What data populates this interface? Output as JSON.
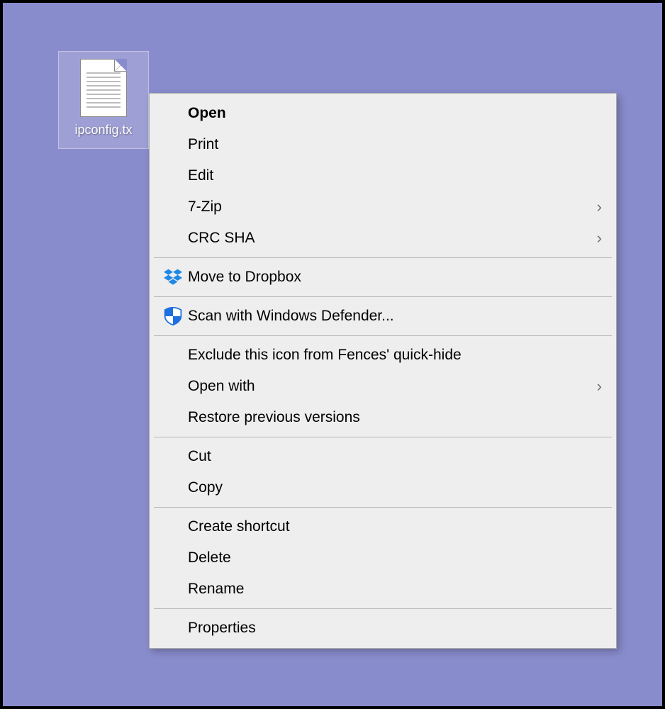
{
  "file": {
    "name": "ipconfig.tx"
  },
  "menu": {
    "items": [
      {
        "label": "Open",
        "bold": true,
        "submenu": false,
        "icon": null
      },
      {
        "label": "Print",
        "bold": false,
        "submenu": false,
        "icon": null
      },
      {
        "label": "Edit",
        "bold": false,
        "submenu": false,
        "icon": null
      },
      {
        "label": "7-Zip",
        "bold": false,
        "submenu": true,
        "icon": null
      },
      {
        "label": "CRC SHA",
        "bold": false,
        "submenu": true,
        "icon": null
      },
      {
        "separator": true
      },
      {
        "label": "Move to Dropbox",
        "bold": false,
        "submenu": false,
        "icon": "dropbox"
      },
      {
        "separator": true
      },
      {
        "label": "Scan with Windows Defender...",
        "bold": false,
        "submenu": false,
        "icon": "defender"
      },
      {
        "separator": true
      },
      {
        "label": "Exclude this icon from Fences' quick-hide",
        "bold": false,
        "submenu": false,
        "icon": null
      },
      {
        "label": "Open with",
        "bold": false,
        "submenu": true,
        "icon": null
      },
      {
        "label": "Restore previous versions",
        "bold": false,
        "submenu": false,
        "icon": null
      },
      {
        "separator": true
      },
      {
        "label": "Cut",
        "bold": false,
        "submenu": false,
        "icon": null
      },
      {
        "label": "Copy",
        "bold": false,
        "submenu": false,
        "icon": null
      },
      {
        "separator": true
      },
      {
        "label": "Create shortcut",
        "bold": false,
        "submenu": false,
        "icon": null
      },
      {
        "label": "Delete",
        "bold": false,
        "submenu": false,
        "icon": null
      },
      {
        "label": "Rename",
        "bold": false,
        "submenu": false,
        "icon": null
      },
      {
        "separator": true
      },
      {
        "label": "Properties",
        "bold": false,
        "submenu": false,
        "icon": null
      }
    ]
  }
}
